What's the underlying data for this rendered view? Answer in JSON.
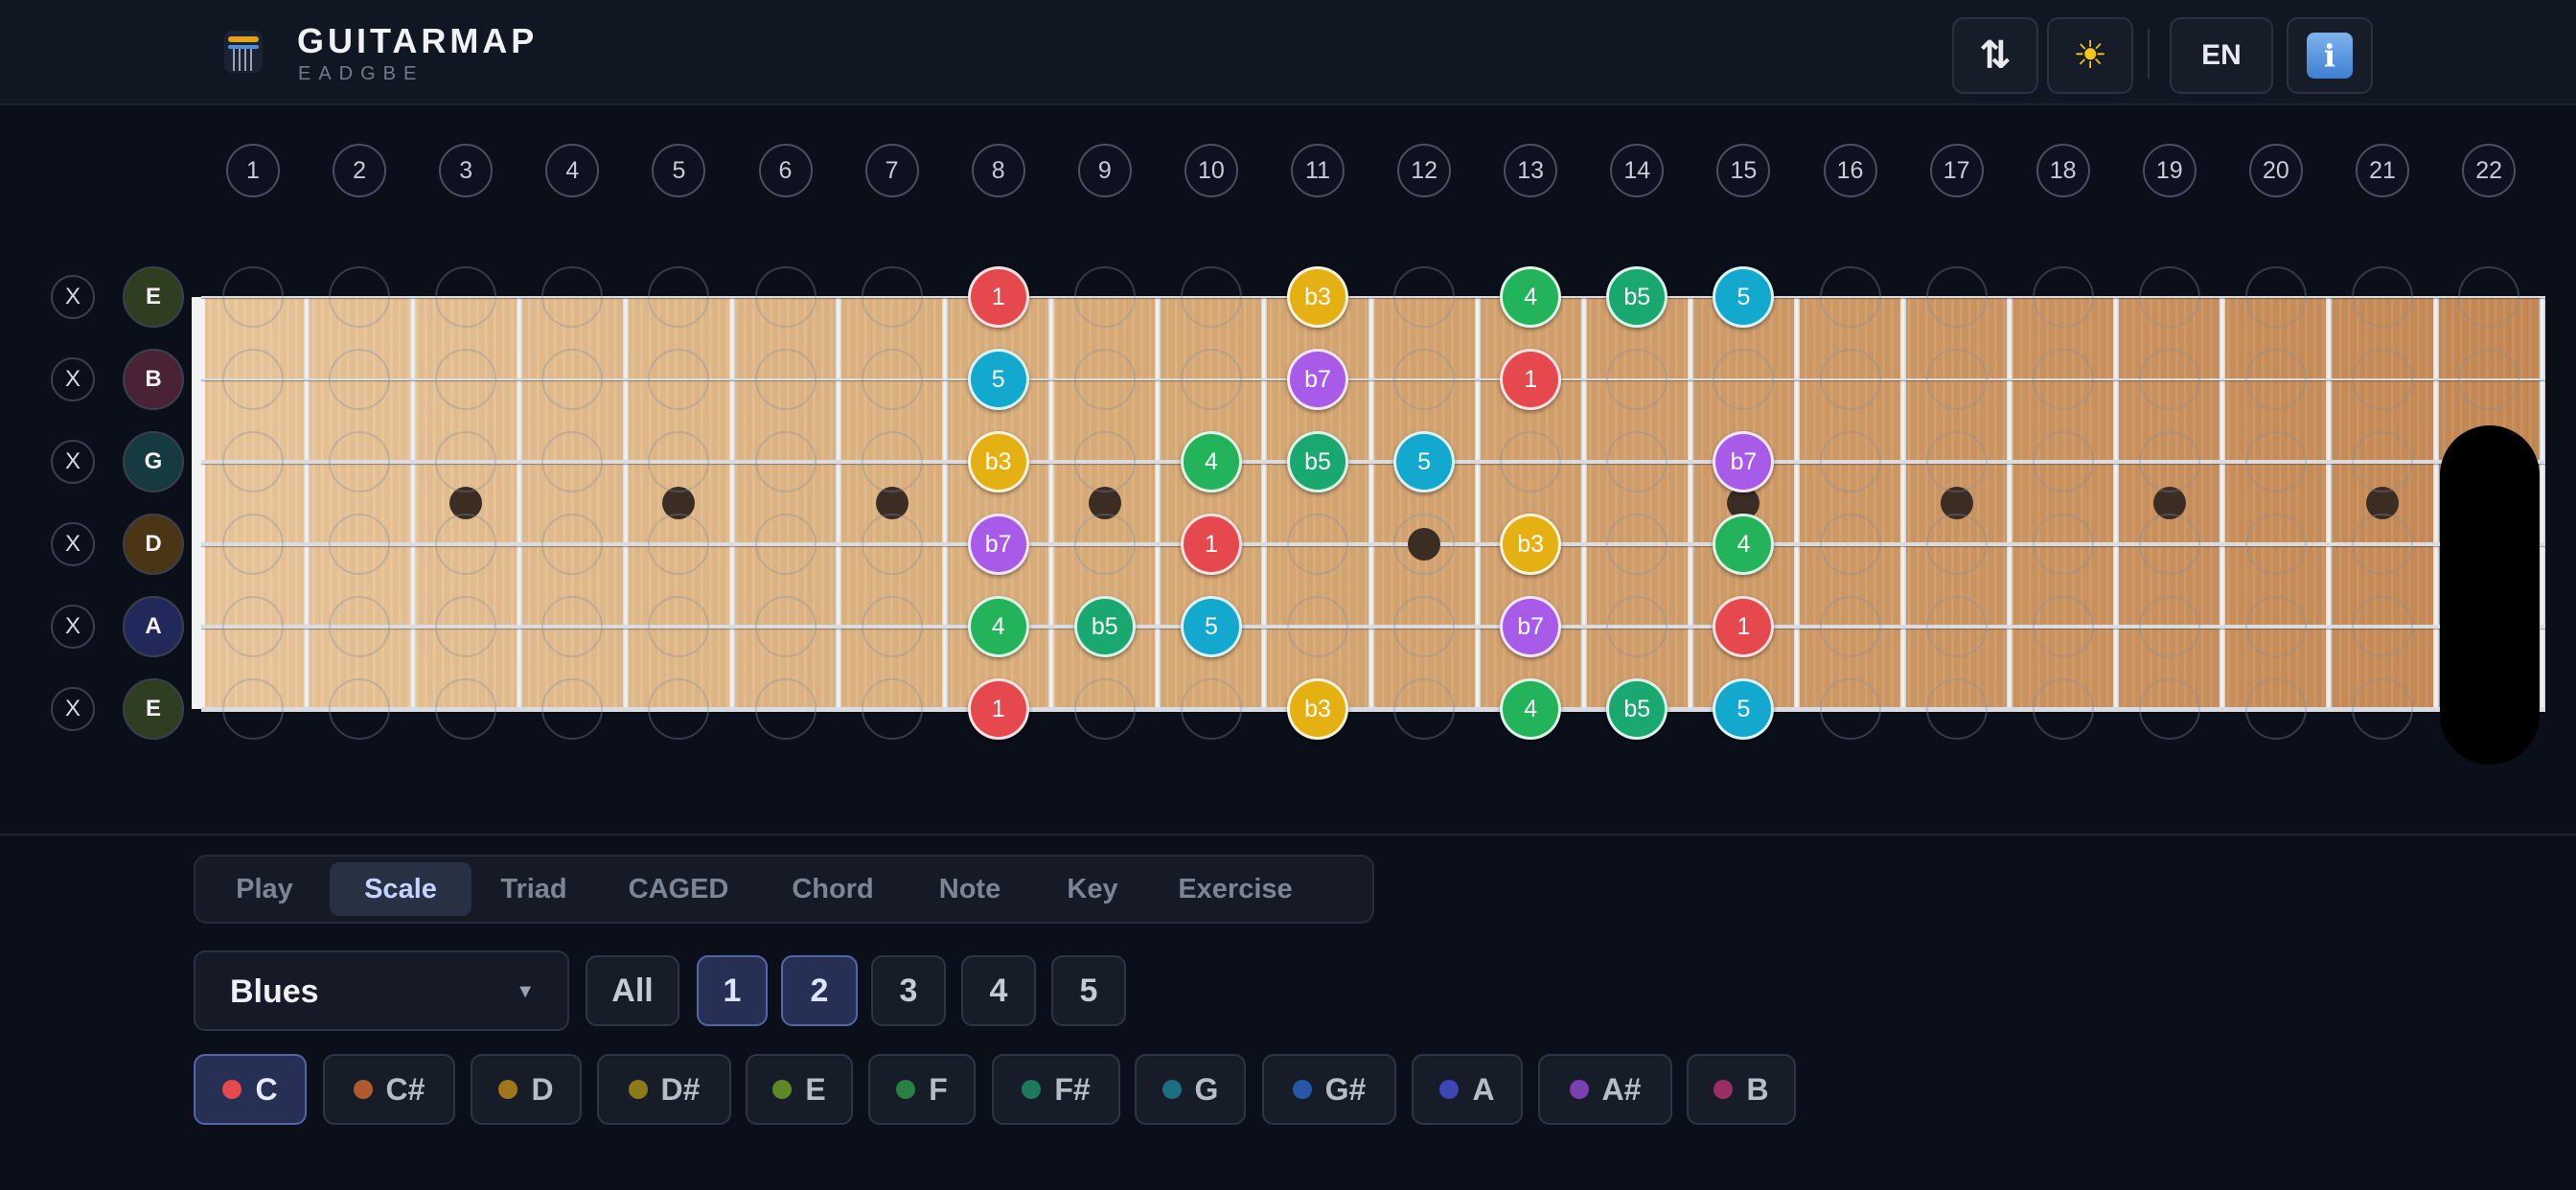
{
  "header": {
    "title": "GUITARMAP",
    "tuning": "EADGBE",
    "swap_icon": "⇅",
    "theme_icon": "☀",
    "lang": "EN",
    "info_icon": "i"
  },
  "fret_numbers": [
    "1",
    "2",
    "3",
    "4",
    "5",
    "6",
    "7",
    "8",
    "9",
    "10",
    "11",
    "12",
    "13",
    "14",
    "15",
    "16",
    "17",
    "18",
    "19",
    "20",
    "21",
    "22"
  ],
  "strings": [
    {
      "mute": "X",
      "open": "E",
      "color": "#2f3d21"
    },
    {
      "mute": "X",
      "open": "B",
      "color": "#4a2235"
    },
    {
      "mute": "X",
      "open": "G",
      "color": "#153a40"
    },
    {
      "mute": "X",
      "open": "D",
      "color": "#4a3615"
    },
    {
      "mute": "X",
      "open": "A",
      "color": "#23285a"
    },
    {
      "mute": "X",
      "open": "E",
      "color": "#2f3d21"
    }
  ],
  "inlays": [
    3,
    5,
    7,
    9,
    12,
    15,
    17,
    19,
    21
  ],
  "notes": [
    {
      "string": 0,
      "fret": 8,
      "label": "1",
      "color": "#e5484d"
    },
    {
      "string": 0,
      "fret": 11,
      "label": "b3",
      "color": "#e4b012"
    },
    {
      "string": 0,
      "fret": 13,
      "label": "4",
      "color": "#22b35b"
    },
    {
      "string": 0,
      "fret": 14,
      "label": "b5",
      "color": "#18a870"
    },
    {
      "string": 0,
      "fret": 15,
      "label": "5",
      "color": "#13a9cf"
    },
    {
      "string": 1,
      "fret": 8,
      "label": "5",
      "color": "#13a9cf"
    },
    {
      "string": 1,
      "fret": 11,
      "label": "b7",
      "color": "#a85be8"
    },
    {
      "string": 1,
      "fret": 13,
      "label": "1",
      "color": "#e5484d"
    },
    {
      "string": 2,
      "fret": 8,
      "label": "b3",
      "color": "#e4b012"
    },
    {
      "string": 2,
      "fret": 10,
      "label": "4",
      "color": "#22b35b"
    },
    {
      "string": 2,
      "fret": 11,
      "label": "b5",
      "color": "#18a870"
    },
    {
      "string": 2,
      "fret": 12,
      "label": "5",
      "color": "#13a9cf"
    },
    {
      "string": 2,
      "fret": 15,
      "label": "b7",
      "color": "#a85be8"
    },
    {
      "string": 3,
      "fret": 8,
      "label": "b7",
      "color": "#a85be8"
    },
    {
      "string": 3,
      "fret": 10,
      "label": "1",
      "color": "#e5484d"
    },
    {
      "string": 3,
      "fret": 13,
      "label": "b3",
      "color": "#e4b012"
    },
    {
      "string": 3,
      "fret": 15,
      "label": "4",
      "color": "#22b35b"
    },
    {
      "string": 4,
      "fret": 8,
      "label": "4",
      "color": "#22b35b"
    },
    {
      "string": 4,
      "fret": 9,
      "label": "b5",
      "color": "#18a870"
    },
    {
      "string": 4,
      "fret": 10,
      "label": "5",
      "color": "#13a9cf"
    },
    {
      "string": 4,
      "fret": 13,
      "label": "b7",
      "color": "#a85be8"
    },
    {
      "string": 4,
      "fret": 15,
      "label": "1",
      "color": "#e5484d"
    },
    {
      "string": 5,
      "fret": 8,
      "label": "1",
      "color": "#e5484d"
    },
    {
      "string": 5,
      "fret": 11,
      "label": "b3",
      "color": "#e4b012"
    },
    {
      "string": 5,
      "fret": 13,
      "label": "4",
      "color": "#22b35b"
    },
    {
      "string": 5,
      "fret": 14,
      "label": "b5",
      "color": "#18a870"
    },
    {
      "string": 5,
      "fret": 15,
      "label": "5",
      "color": "#13a9cf"
    }
  ],
  "tabs": [
    {
      "label": "Play",
      "active": false
    },
    {
      "label": "Scale",
      "active": true
    },
    {
      "label": "Triad",
      "active": false
    },
    {
      "label": "CAGED",
      "active": false
    },
    {
      "label": "Chord",
      "active": false
    },
    {
      "label": "Note",
      "active": false
    },
    {
      "label": "Key",
      "active": false
    },
    {
      "label": "Exercise",
      "active": false
    }
  ],
  "scale_select": {
    "value": "Blues",
    "arrow": "▼"
  },
  "positions": [
    {
      "label": "All",
      "active": false
    },
    {
      "label": "1",
      "active": true
    },
    {
      "label": "2",
      "active": true
    },
    {
      "label": "3",
      "active": false
    },
    {
      "label": "4",
      "active": false
    },
    {
      "label": "5",
      "active": false
    }
  ],
  "keys": [
    {
      "label": "C",
      "color": "#e5484d",
      "active": true
    },
    {
      "label": "C#",
      "color": "#b05a2e",
      "active": false
    },
    {
      "label": "D",
      "color": "#a0761c",
      "active": false
    },
    {
      "label": "D#",
      "color": "#8e7a1a",
      "active": false
    },
    {
      "label": "E",
      "color": "#5d8a24",
      "active": false
    },
    {
      "label": "F",
      "color": "#2a7f43",
      "active": false
    },
    {
      "label": "F#",
      "color": "#1d7a5c",
      "active": false
    },
    {
      "label": "G",
      "color": "#1c6f80",
      "active": false
    },
    {
      "label": "G#",
      "color": "#2a56a8",
      "active": false
    },
    {
      "label": "A",
      "color": "#3e45b5",
      "active": false
    },
    {
      "label": "A#",
      "color": "#7a3fb0",
      "active": false
    },
    {
      "label": "B",
      "color": "#9c2e66",
      "active": false
    }
  ]
}
